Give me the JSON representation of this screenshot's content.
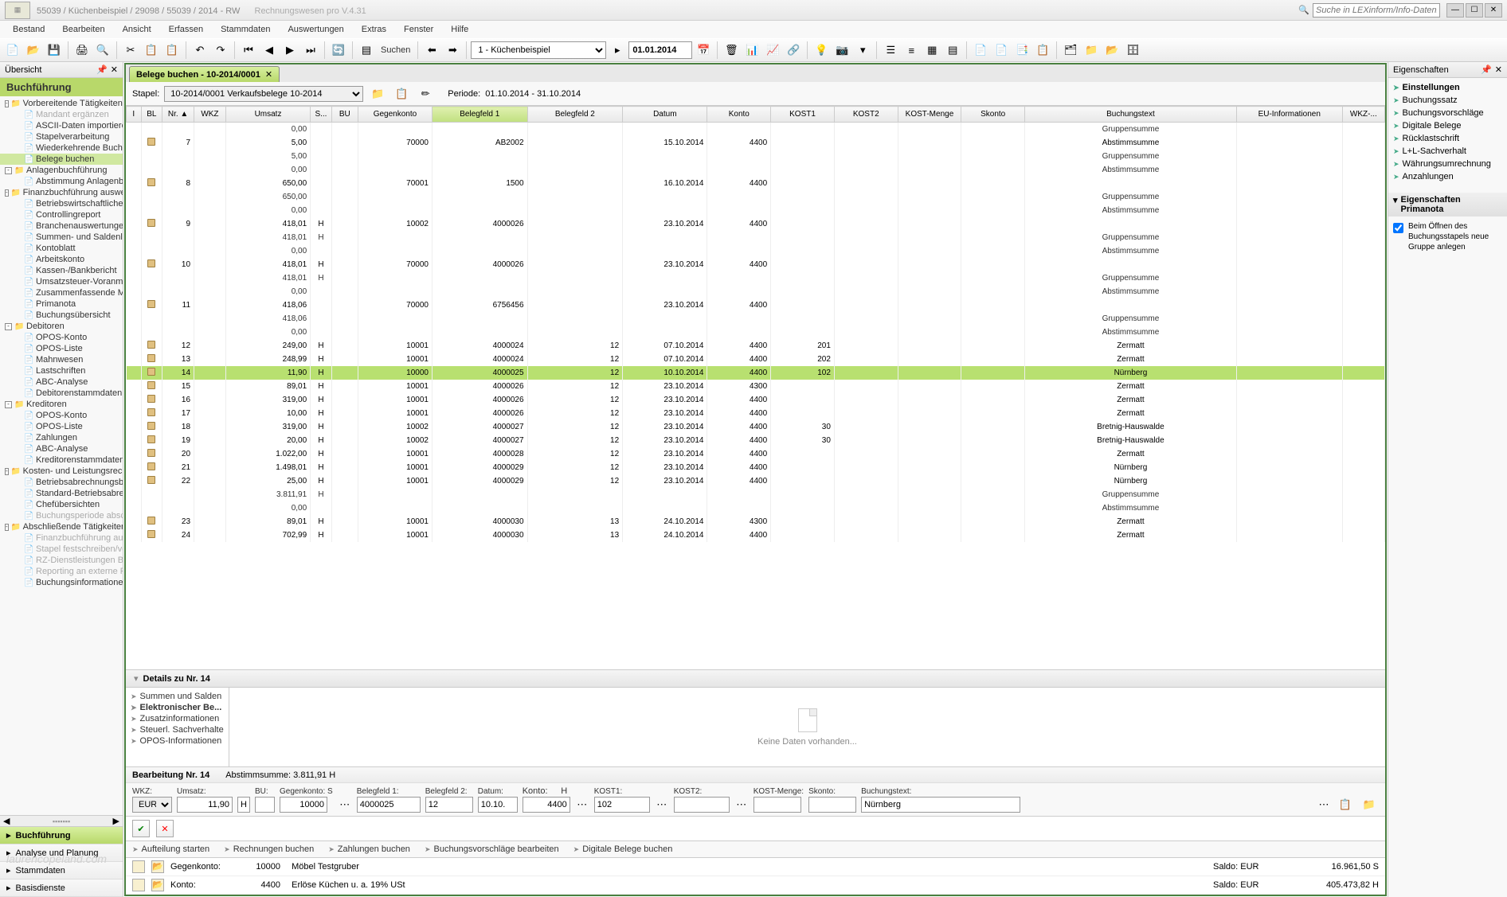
{
  "title": "55039 / Küchenbeispiel / 29098 / 55039 / 2014 - RW",
  "app_sub": "Rechnungswesen pro V.4.31",
  "search_placeholder": "Suche in LEXinform/Info-Datenbank",
  "menus": [
    "Bestand",
    "Bearbeiten",
    "Ansicht",
    "Erfassen",
    "Stammdaten",
    "Auswertungen",
    "Extras",
    "Fenster",
    "Hilfe"
  ],
  "toolbar": {
    "suchen": "Suchen",
    "combo_mandant": "1 - Küchenbeispiel",
    "date": "01.01.2014"
  },
  "left": {
    "overview": "Übersicht",
    "section": "Buchführung",
    "tree": [
      {
        "l": 1,
        "exp": "-",
        "ico": "folder",
        "t": "Vorbereitende Tätigkeiten"
      },
      {
        "l": 2,
        "ico": "doc",
        "t": "Mandant ergänzen",
        "dis": true
      },
      {
        "l": 2,
        "ico": "doc",
        "t": "ASCII-Daten importieren"
      },
      {
        "l": 2,
        "ico": "doc",
        "t": "Stapelverarbeitung"
      },
      {
        "l": 2,
        "ico": "doc",
        "t": "Wiederkehrende Buchung..."
      },
      {
        "l": 2,
        "ico": "doc",
        "t": "Belege buchen",
        "sel": true
      },
      {
        "l": 1,
        "exp": "-",
        "ico": "folder",
        "t": "Anlagenbuchführung"
      },
      {
        "l": 2,
        "ico": "doc",
        "t": "Abstimmung Anlagenbuch..."
      },
      {
        "l": 1,
        "exp": "-",
        "ico": "folder",
        "t": "Finanzbuchführung auswerten"
      },
      {
        "l": 2,
        "ico": "doc",
        "t": "Betriebswirtschaftliche Aus..."
      },
      {
        "l": 2,
        "ico": "doc",
        "t": "Controllingreport"
      },
      {
        "l": 2,
        "ico": "doc",
        "t": "Branchenauswertungen"
      },
      {
        "l": 2,
        "ico": "doc",
        "t": "Summen- und Saldenliste"
      },
      {
        "l": 2,
        "ico": "doc",
        "t": "Kontoblatt"
      },
      {
        "l": 2,
        "ico": "doc",
        "t": "Arbeitskonto"
      },
      {
        "l": 2,
        "ico": "doc",
        "t": "Kassen-/Bankbericht"
      },
      {
        "l": 2,
        "ico": "doc",
        "t": "Umsatzsteuer-Voranmeldung"
      },
      {
        "l": 2,
        "ico": "doc",
        "t": "Zusammenfassende Meldu..."
      },
      {
        "l": 2,
        "ico": "doc",
        "t": "Primanota"
      },
      {
        "l": 2,
        "ico": "doc",
        "t": "Buchungsübersicht"
      },
      {
        "l": 1,
        "exp": "-",
        "ico": "folder",
        "t": "Debitoren"
      },
      {
        "l": 2,
        "ico": "doc",
        "t": "OPOS-Konto"
      },
      {
        "l": 2,
        "ico": "doc",
        "t": "OPOS-Liste"
      },
      {
        "l": 2,
        "ico": "doc",
        "t": "Mahnwesen"
      },
      {
        "l": 2,
        "ico": "doc",
        "t": "Lastschriften"
      },
      {
        "l": 2,
        "ico": "doc",
        "t": "ABC-Analyse"
      },
      {
        "l": 2,
        "ico": "doc",
        "t": "Debitorenstammdaten"
      },
      {
        "l": 1,
        "exp": "-",
        "ico": "folder",
        "t": "Kreditoren"
      },
      {
        "l": 2,
        "ico": "doc",
        "t": "OPOS-Konto"
      },
      {
        "l": 2,
        "ico": "doc",
        "t": "OPOS-Liste"
      },
      {
        "l": 2,
        "ico": "doc",
        "t": "Zahlungen"
      },
      {
        "l": 2,
        "ico": "doc",
        "t": "ABC-Analyse"
      },
      {
        "l": 2,
        "ico": "doc",
        "t": "Kreditorenstammdaten"
      },
      {
        "l": 1,
        "exp": "-",
        "ico": "folder",
        "t": "Kosten- und Leistungsrechnung"
      },
      {
        "l": 2,
        "ico": "doc",
        "t": "Betriebsabrechnungsbogen"
      },
      {
        "l": 2,
        "ico": "doc",
        "t": "Standard-Betriebsabrechn..."
      },
      {
        "l": 2,
        "ico": "doc",
        "t": "Chefübersichten"
      },
      {
        "l": 2,
        "ico": "doc",
        "t": "Buchungsperiode abschließen",
        "dis": true
      },
      {
        "l": 1,
        "exp": "-",
        "ico": "folder",
        "t": "Abschließende Tätigkeiten"
      },
      {
        "l": 2,
        "ico": "doc",
        "t": "Finanzbuchführung ausge...",
        "dis": true
      },
      {
        "l": 2,
        "ico": "doc",
        "t": "Stapel festschreiben/verw...",
        "dis": true
      },
      {
        "l": 2,
        "ico": "doc",
        "t": "RZ-Dienstleistungen Buchf...",
        "dis": true
      },
      {
        "l": 2,
        "ico": "doc",
        "t": "Reporting an externe Partner",
        "dis": true
      },
      {
        "l": 2,
        "ico": "doc",
        "t": "Buchungsinformationen üb..."
      }
    ],
    "bottom": [
      {
        "t": "Buchführung",
        "active": true
      },
      {
        "t": "Analyse und Planung"
      },
      {
        "t": "Stammdaten"
      },
      {
        "t": "Basisdienste"
      }
    ]
  },
  "tab": {
    "label": "Belege buchen  - 10-2014/0001"
  },
  "stapel": {
    "label": "Stapel:",
    "value": "10-2014/0001   Verkaufsbelege 10-2014",
    "periode_label": "Periode:",
    "periode": "01.10.2014 - 31.10.2014"
  },
  "grid": {
    "cols": [
      "I",
      "BL",
      "Nr. ▲",
      "WKZ",
      "Umsatz",
      "S...",
      "BU",
      "Gegenkonto",
      "Belegfeld 1",
      "Belegfeld 2",
      "Datum",
      "Konto",
      "KOST1",
      "KOST2",
      "KOST-Menge",
      "Skonto",
      "Buchungstext",
      "EU-Informationen",
      "WKZ-..."
    ],
    "rows": [
      {
        "um": "0,00",
        "bt": "Gruppensumme",
        "sum": true
      },
      {
        "bl": true,
        "nr": "7",
        "um": "5,00",
        "gk": "70000",
        "bf1": "AB2002",
        "dat": "15.10.2014",
        "kto": "4400",
        "bt": "Abstimmsumme"
      },
      {
        "um": "5,00",
        "bt": "Gruppensumme",
        "sum": true
      },
      {
        "um": "0,00",
        "bt": "Abstimmsumme",
        "sum": true
      },
      {
        "bl": true,
        "nr": "8",
        "um": "650,00",
        "gk": "70001",
        "bf1": "1500",
        "dat": "16.10.2014",
        "kto": "4400"
      },
      {
        "um": "650,00",
        "bt": "Gruppensumme",
        "sum": true
      },
      {
        "um": "0,00",
        "bt": "Abstimmsumme",
        "sum": true
      },
      {
        "bl": true,
        "nr": "9",
        "um": "418,01",
        "s": "H",
        "gk": "10002",
        "bf1": "4000026",
        "dat": "23.10.2014",
        "kto": "4400"
      },
      {
        "um": "418,01",
        "s": "H",
        "bt": "Gruppensumme",
        "sum": true
      },
      {
        "um": "0,00",
        "bt": "Abstimmsumme",
        "sum": true
      },
      {
        "bl": true,
        "nr": "10",
        "um": "418,01",
        "s": "H",
        "gk": "70000",
        "bf1": "4000026",
        "dat": "23.10.2014",
        "kto": "4400"
      },
      {
        "um": "418,01",
        "s": "H",
        "bt": "Gruppensumme",
        "sum": true
      },
      {
        "um": "0,00",
        "bt": "Abstimmsumme",
        "sum": true
      },
      {
        "bl": true,
        "nr": "11",
        "um": "418,06",
        "gk": "70000",
        "bf1": "6756456",
        "dat": "23.10.2014",
        "kto": "4400"
      },
      {
        "um": "418,06",
        "bt": "Gruppensumme",
        "sum": true
      },
      {
        "um": "0,00",
        "bt": "Abstimmsumme",
        "sum": true
      },
      {
        "bl": true,
        "nr": "12",
        "um": "249,00",
        "s": "H",
        "gk": "10001",
        "bf1": "4000024",
        "bf2": "12",
        "dat": "07.10.2014",
        "kto": "4400",
        "k1": "201",
        "bt": "Zermatt"
      },
      {
        "bl": true,
        "nr": "13",
        "um": "248,99",
        "s": "H",
        "gk": "10001",
        "bf1": "4000024",
        "bf2": "12",
        "dat": "07.10.2014",
        "kto": "4400",
        "k1": "202",
        "bt": "Zermatt"
      },
      {
        "bl": true,
        "nr": "14",
        "um": "11,90",
        "s": "H",
        "gk": "10000",
        "bf1": "4000025",
        "bf2": "12",
        "dat": "10.10.2014",
        "kto": "4400",
        "k1": "102",
        "bt": "Nürnberg",
        "sel": true
      },
      {
        "bl": true,
        "nr": "15",
        "um": "89,01",
        "s": "H",
        "gk": "10001",
        "bf1": "4000026",
        "bf2": "12",
        "dat": "23.10.2014",
        "kto": "4300",
        "bt": "Zermatt"
      },
      {
        "bl": true,
        "nr": "16",
        "um": "319,00",
        "s": "H",
        "gk": "10001",
        "bf1": "4000026",
        "bf2": "12",
        "dat": "23.10.2014",
        "kto": "4400",
        "bt": "Zermatt"
      },
      {
        "bl": true,
        "nr": "17",
        "um": "10,00",
        "s": "H",
        "gk": "10001",
        "bf1": "4000026",
        "bf2": "12",
        "dat": "23.10.2014",
        "kto": "4400",
        "bt": "Zermatt"
      },
      {
        "bl": true,
        "nr": "18",
        "um": "319,00",
        "s": "H",
        "gk": "10002",
        "bf1": "4000027",
        "bf2": "12",
        "dat": "23.10.2014",
        "kto": "4400",
        "k1": "30",
        "bt": "Bretnig-Hauswalde"
      },
      {
        "bl": true,
        "nr": "19",
        "um": "20,00",
        "s": "H",
        "gk": "10002",
        "bf1": "4000027",
        "bf2": "12",
        "dat": "23.10.2014",
        "kto": "4400",
        "k1": "30",
        "bt": "Bretnig-Hauswalde"
      },
      {
        "bl": true,
        "nr": "20",
        "um": "1.022,00",
        "s": "H",
        "gk": "10001",
        "bf1": "4000028",
        "bf2": "12",
        "dat": "23.10.2014",
        "kto": "4400",
        "bt": "Zermatt"
      },
      {
        "bl": true,
        "nr": "21",
        "um": "1.498,01",
        "s": "H",
        "gk": "10001",
        "bf1": "4000029",
        "bf2": "12",
        "dat": "23.10.2014",
        "kto": "4400",
        "bt": "Nürnberg"
      },
      {
        "bl": true,
        "nr": "22",
        "um": "25,00",
        "s": "H",
        "gk": "10001",
        "bf1": "4000029",
        "bf2": "12",
        "dat": "23.10.2014",
        "kto": "4400",
        "bt": "Nürnberg"
      },
      {
        "um": "3.811,91",
        "s": "H",
        "bt": "Gruppensumme",
        "sum": true
      },
      {
        "um": "0,00",
        "bt": "Abstimmsumme",
        "sum": true
      },
      {
        "bl": true,
        "nr": "23",
        "um": "89,01",
        "s": "H",
        "gk": "10001",
        "bf1": "4000030",
        "bf2": "13",
        "dat": "24.10.2014",
        "kto": "4300",
        "bt": "Zermatt"
      },
      {
        "bl": true,
        "nr": "24",
        "um": "702,99",
        "s": "H",
        "gk": "10001",
        "bf1": "4000030",
        "bf2": "13",
        "dat": "24.10.2014",
        "kto": "4400",
        "bt": "Zermatt"
      }
    ]
  },
  "details": {
    "title": "Details zu Nr. 14",
    "tabs": [
      "Summen und Salden",
      "Elektronischer Be...",
      "Zusatzinformationen",
      "Steuerl. Sachverhalte",
      "OPOS-Informationen"
    ],
    "empty": "Keine Daten vorhanden..."
  },
  "edit": {
    "header": "Bearbeitung Nr. 14",
    "abstimm_label": "Abstimmsumme:",
    "abstimm": "3.811,91 H",
    "fields": {
      "wkz": {
        "label": "WKZ:",
        "val": "EUR"
      },
      "umsatz": {
        "label": "Umsatz:",
        "val": "11,90"
      },
      "sh": {
        "val": "H"
      },
      "bu": {
        "label": "BU:",
        "val": ""
      },
      "gk": {
        "label": "Gegenkonto: S",
        "val": "10000"
      },
      "bf1": {
        "label": "Belegfeld 1:",
        "val": "4000025"
      },
      "bf2": {
        "label": "Belegfeld 2:",
        "val": "12"
      },
      "datum": {
        "label": "Datum:",
        "val": "10.10."
      },
      "konto": {
        "label": "Konto:",
        "sh": "H",
        "val": "4400"
      },
      "kost1": {
        "label": "KOST1:",
        "val": "102"
      },
      "kost2": {
        "label": "KOST2:",
        "val": ""
      },
      "kostm": {
        "label": "KOST-Menge:",
        "val": ""
      },
      "skonto": {
        "label": "Skonto:",
        "val": ""
      },
      "bt": {
        "label": "Buchungstext:",
        "val": "Nürnberg"
      }
    }
  },
  "links": [
    "Aufteilung starten",
    "Rechnungen buchen",
    "Zahlungen buchen",
    "Buchungsvorschläge bearbeiten",
    "Digitale Belege buchen"
  ],
  "konto": [
    {
      "label": "Gegenkonto:",
      "nr": "10000",
      "name": "Möbel Testgruber",
      "saldo_label": "Saldo:  EUR",
      "saldo": "16.961,50  S"
    },
    {
      "label": "Konto:",
      "nr": "4400",
      "name": "Erlöse Küchen u. a. 19% USt",
      "saldo_label": "Saldo:  EUR",
      "saldo": "405.473,82  H"
    }
  ],
  "right": {
    "header": "Eigenschaften",
    "settings_hdr": "Einstellungen",
    "items": [
      "Buchungssatz",
      "Buchungsvorschläge",
      "Digitale Belege",
      "Rücklastschrift",
      "L+L-Sachverhalt",
      "Währungsumrechnung",
      "Anzahlungen"
    ],
    "sub_hdr": "Eigenschaften Primanota",
    "check_label": "Beim Öffnen des Buchungsstapels neue Gruppe anlegen"
  },
  "watermark": "laurencopeland.com"
}
